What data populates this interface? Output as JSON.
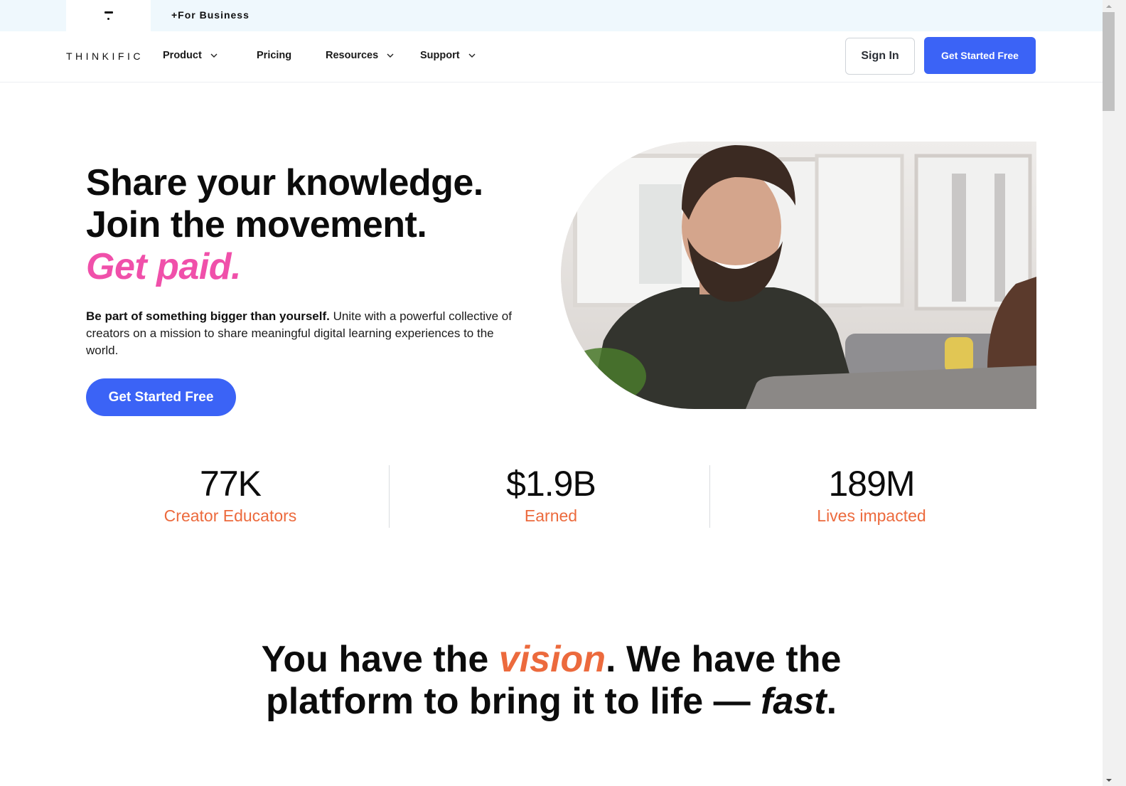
{
  "topbar": {
    "logo_icon": "thinkific-t-mark-icon",
    "for_business": "+For Business"
  },
  "nav": {
    "brand": "THINKIFIC",
    "items": [
      {
        "label": "Product",
        "has_dropdown": true
      },
      {
        "label": "Pricing",
        "has_dropdown": false
      },
      {
        "label": "Resources",
        "has_dropdown": true
      },
      {
        "label": "Support",
        "has_dropdown": true
      }
    ],
    "sign_in": "Sign In",
    "get_started": "Get Started Free"
  },
  "hero": {
    "title_line1": "Share your knowledge.",
    "title_line2": "Join the movement.",
    "title_line3": "Get paid.",
    "desc_bold": "Be part of something bigger than yourself.",
    "desc_rest": " Unite with a powerful collective of creators on a mission to share meaningful digital learning experiences to the world.",
    "cta": "Get Started Free",
    "image_alt": "smiling bearded man working on a laptop"
  },
  "stats": [
    {
      "value": "77K",
      "label": "Creator Educators"
    },
    {
      "value": "$1.9B",
      "label": "Earned"
    },
    {
      "value": "189M",
      "label": "Lives impacted"
    }
  ],
  "tagline": {
    "part1": "You have the ",
    "highlight": "vision",
    "part2": ". We have the",
    "part3": "platform to bring it to life — ",
    "emphasis": "fast",
    "part4": "."
  },
  "colors": {
    "primary": "#3b63f6",
    "pink_accent": "#f050aa",
    "orange_accent": "#ec6a3d",
    "topbar_bg": "#eff8fd"
  }
}
